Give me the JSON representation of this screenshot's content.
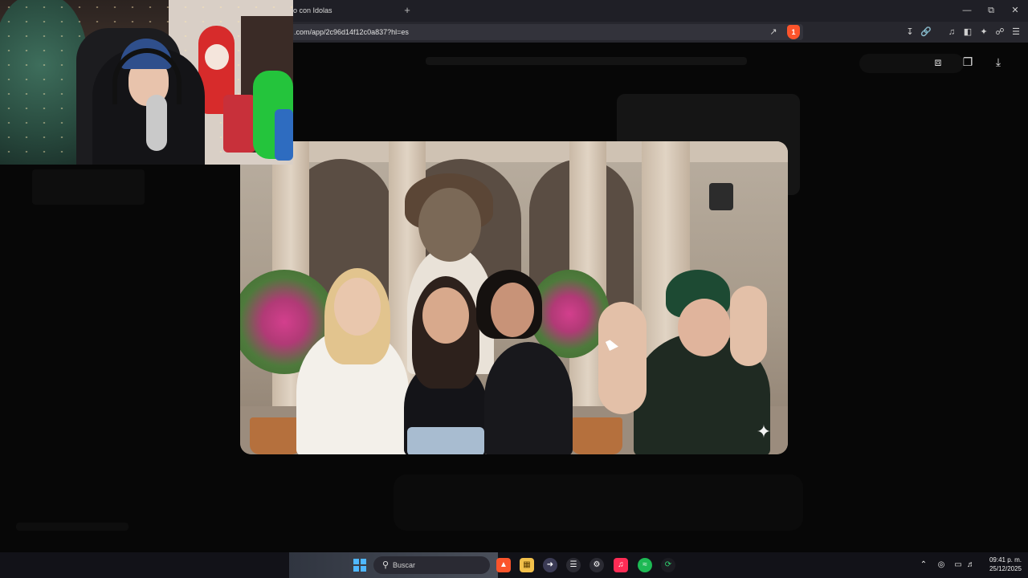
{
  "browser": {
    "tab_title": "o con Idolas",
    "new_tab_label": "+",
    "url": ".com/app/2c96d14f12c0a837?hl=es",
    "shield_badge": "1"
  },
  "taskbar": {
    "search_placeholder": "Buscar",
    "time": "09:41 p. m.",
    "date": "25/12/2025"
  },
  "colors": {
    "accent": "#fb542b",
    "tiktok": "#fe2c55",
    "spotify": "#1db954",
    "windows": "#4fb7ff"
  },
  "icons": {
    "tab_new": "plus-icon",
    "share_page": "share-icon",
    "brave": "brave-shield-icon",
    "viewer_share": "share-icon",
    "viewer_copy": "copy-icon",
    "viewer_download": "download-icon"
  }
}
